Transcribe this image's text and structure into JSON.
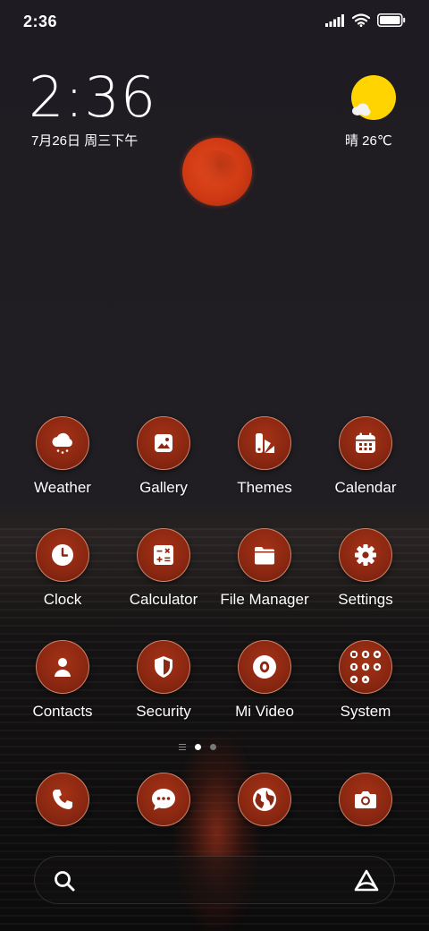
{
  "status_bar": {
    "time": "2:36",
    "icons": [
      "signal-icon",
      "wifi-icon",
      "battery-icon"
    ]
  },
  "clock_widget": {
    "time": "2:36",
    "date": "7月26日 周三下午"
  },
  "weather_widget": {
    "icon": "sun-cloud-icon",
    "text": "晴 26℃"
  },
  "apps": [
    {
      "label": "Weather",
      "icon": "weather-icon"
    },
    {
      "label": "Gallery",
      "icon": "gallery-icon"
    },
    {
      "label": "Themes",
      "icon": "themes-icon"
    },
    {
      "label": "Calendar",
      "icon": "calendar-icon"
    },
    {
      "label": "Clock",
      "icon": "clock-icon"
    },
    {
      "label": "Calculator",
      "icon": "calculator-icon"
    },
    {
      "label": "File Manager",
      "icon": "folder-icon"
    },
    {
      "label": "Settings",
      "icon": "gear-icon"
    },
    {
      "label": "Contacts",
      "icon": "person-icon"
    },
    {
      "label": "Security",
      "icon": "shield-icon"
    },
    {
      "label": "Mi Video",
      "icon": "video-icon"
    },
    {
      "label": "System",
      "icon": "folder-grid-icon"
    }
  ],
  "page_indicator": {
    "pages": 2,
    "active_page": 1
  },
  "dock": [
    {
      "icon": "phone-icon"
    },
    {
      "icon": "message-icon"
    },
    {
      "icon": "browser-icon"
    },
    {
      "icon": "camera-icon"
    }
  ],
  "search_bar": {
    "left_icon": "search-icon",
    "right_icon": "assistant-icon"
  },
  "colors": {
    "icon_fill": "#8c2812",
    "icon_border": "#ffbea0",
    "moon": "#d43c15",
    "sun": "#ffd400"
  }
}
